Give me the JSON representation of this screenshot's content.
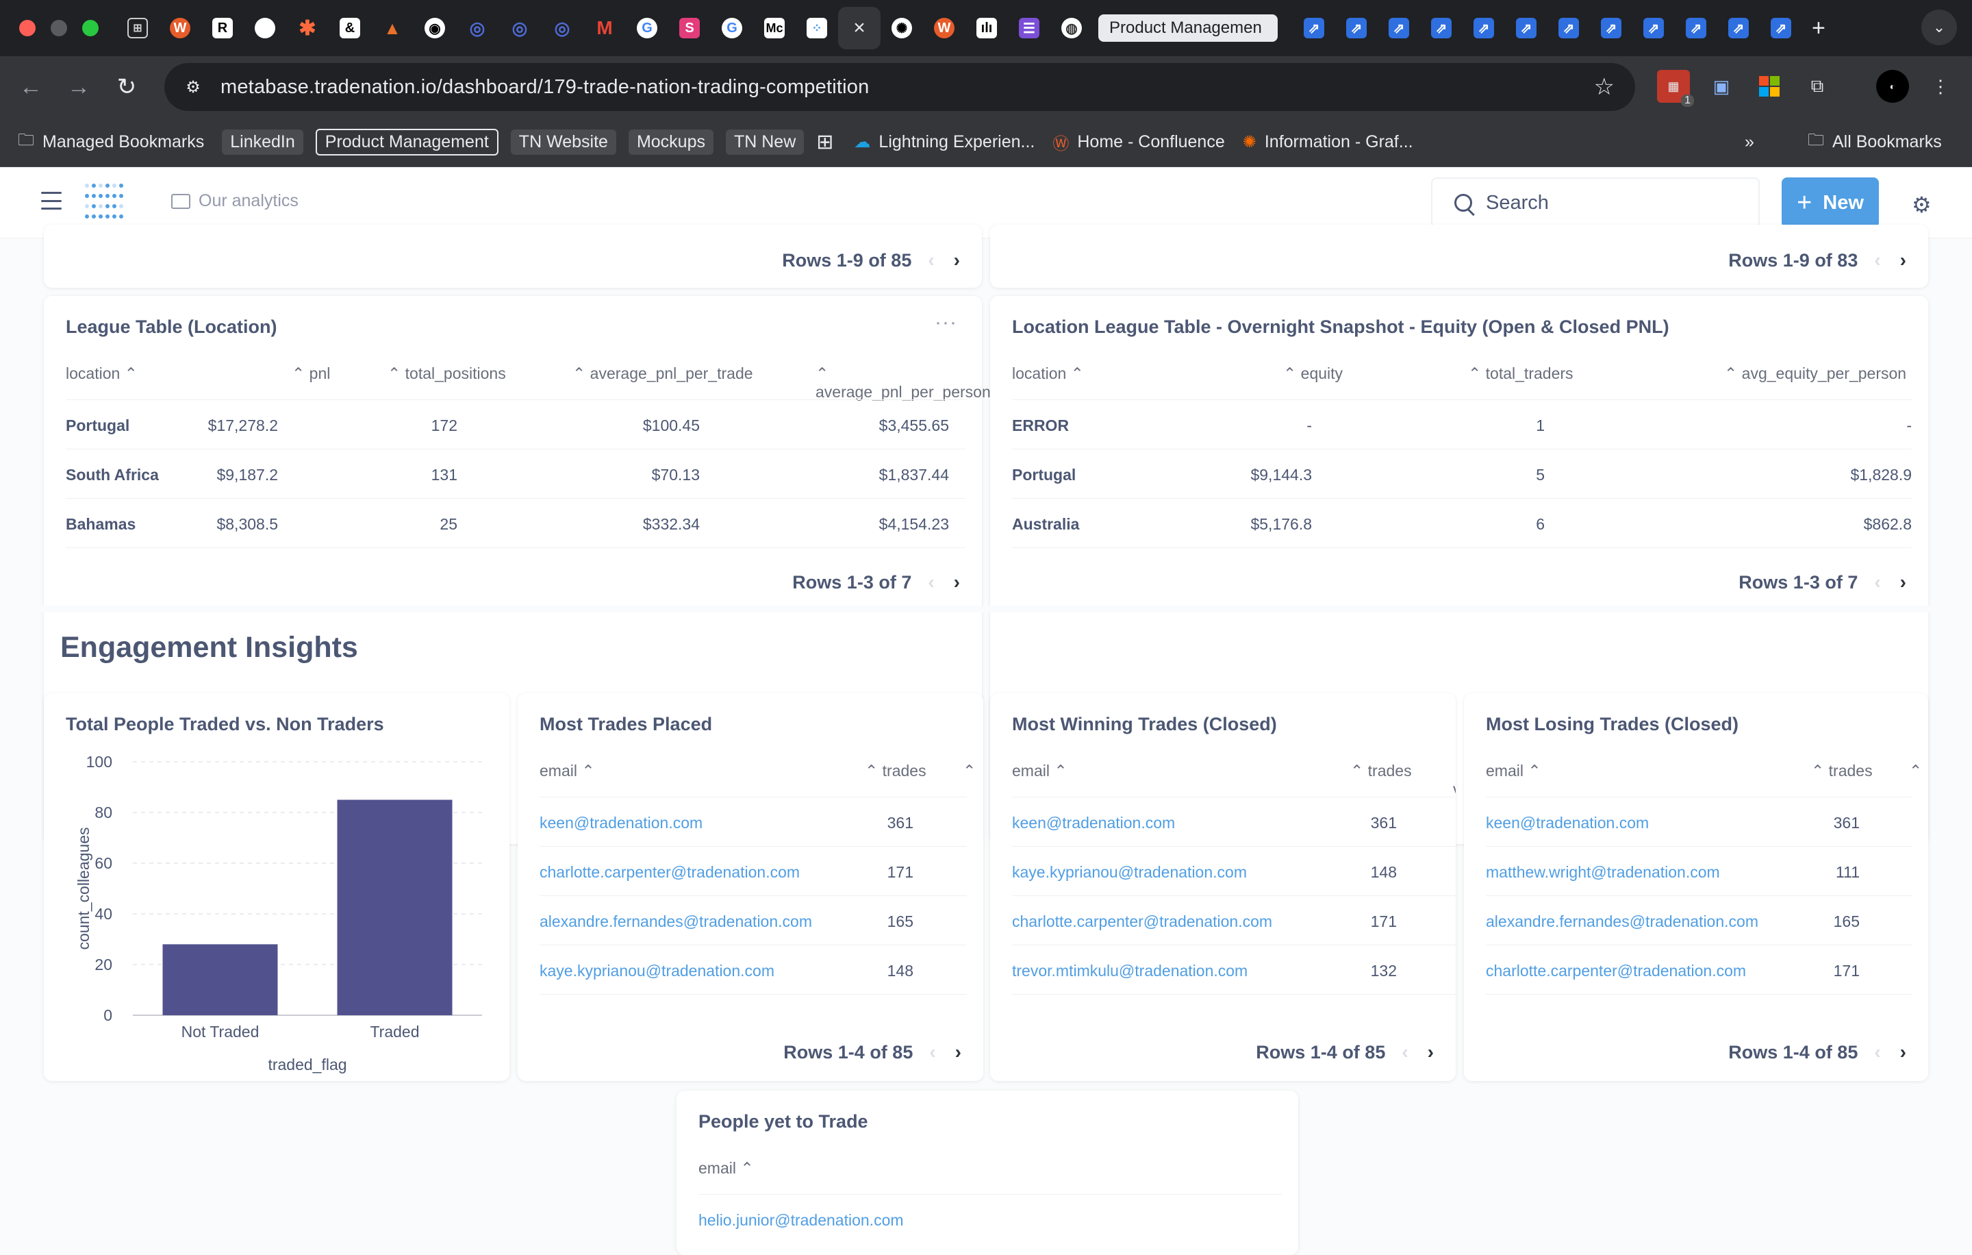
{
  "browser": {
    "active_tab_label": "Product Managemen",
    "url": "metabase.tradenation.io/dashboard/179-trade-nation-trading-competition",
    "bookmarks": [
      "Managed Bookmarks",
      "LinkedIn",
      "Product Management",
      "TN Website",
      "Mockups",
      "TN New",
      "Lightning Experien...",
      "Home - Confluence",
      "Information - Graf..."
    ],
    "all_bookmarks": "All Bookmarks",
    "ext_badge": "1"
  },
  "header": {
    "breadcrumb": "Our analytics",
    "search_placeholder": "Search",
    "new_label": "New",
    "accent": "#509ee3"
  },
  "top_pagers": {
    "left": "Rows 1-9 of 85",
    "right": "Rows 1-9 of 83"
  },
  "league_location": {
    "title": "League Table (Location)",
    "columns": [
      "location",
      "pnl",
      "total_positions",
      "average_pnl_per_trade",
      "average_pnl_per_person"
    ],
    "rows": [
      [
        "Portugal",
        "$17,278.2",
        "172",
        "$100.45",
        "$3,455.65"
      ],
      [
        "South Africa",
        "$9,187.2",
        "131",
        "$70.13",
        "$1,837.44"
      ],
      [
        "Bahamas",
        "$8,308.5",
        "25",
        "$332.34",
        "$4,154.23"
      ]
    ],
    "pager": "Rows 1-3 of 7"
  },
  "overnight": {
    "title": "Location League Table - Overnight Snapshot - Equity (Open & Closed PNL)",
    "columns": [
      "location",
      "equity",
      "total_traders",
      "avg_equity_per_person"
    ],
    "rows": [
      [
        "ERROR",
        "-",
        "1",
        "-"
      ],
      [
        "Portugal",
        "$9,144.3",
        "5",
        "$1,828.9"
      ],
      [
        "Australia",
        "$5,176.8",
        "6",
        "$862.8"
      ]
    ],
    "pager": "Rows 1-3 of 7"
  },
  "section_title": "Engagement Insights",
  "chart_card": {
    "title": "Total People Traded vs. Non Traders"
  },
  "chart_data": {
    "type": "bar",
    "categories": [
      "Not Traded",
      "Traded"
    ],
    "values": [
      28,
      85
    ],
    "xlabel": "traded_flag",
    "ylabel": "count_colleagues",
    "ylim": [
      0,
      100
    ],
    "yticks": [
      "0",
      "20",
      "40",
      "60",
      "80",
      "100"
    ],
    "color": "#51528d",
    "grid": true
  },
  "most_trades": {
    "title": "Most Trades Placed",
    "columns": [
      "email",
      "trades"
    ],
    "rows": [
      [
        "keen@tradenation.com",
        "361"
      ],
      [
        "charlotte.carpenter@tradenation.com",
        "171"
      ],
      [
        "alexandre.fernandes@tradenation.com",
        "165"
      ],
      [
        "kaye.kyprianou@tradenation.com",
        "148"
      ]
    ],
    "pager": "Rows 1-4 of 85"
  },
  "most_winning": {
    "title": "Most Winning Trades (Closed)",
    "columns": [
      "email",
      "trades",
      "v"
    ],
    "rows": [
      [
        "keen@tradenation.com",
        "361"
      ],
      [
        "kaye.kyprianou@tradenation.com",
        "148"
      ],
      [
        "charlotte.carpenter@tradenation.com",
        "171"
      ],
      [
        "trevor.mtimkulu@tradenation.com",
        "132"
      ]
    ],
    "pager": "Rows 1-4 of 85"
  },
  "most_losing": {
    "title": "Most Losing Trades (Closed)",
    "columns": [
      "email",
      "trades"
    ],
    "rows": [
      [
        "keen@tradenation.com",
        "361"
      ],
      [
        "matthew.wright@tradenation.com",
        "111"
      ],
      [
        "alexandre.fernandes@tradenation.com",
        "165"
      ],
      [
        "charlotte.carpenter@tradenation.com",
        "171"
      ]
    ],
    "pager": "Rows 1-4 of 85"
  },
  "yet_to_trade": {
    "title": "People yet to Trade",
    "columns": [
      "email"
    ],
    "rows": [
      [
        "helio.junior@tradenation.com"
      ]
    ]
  }
}
